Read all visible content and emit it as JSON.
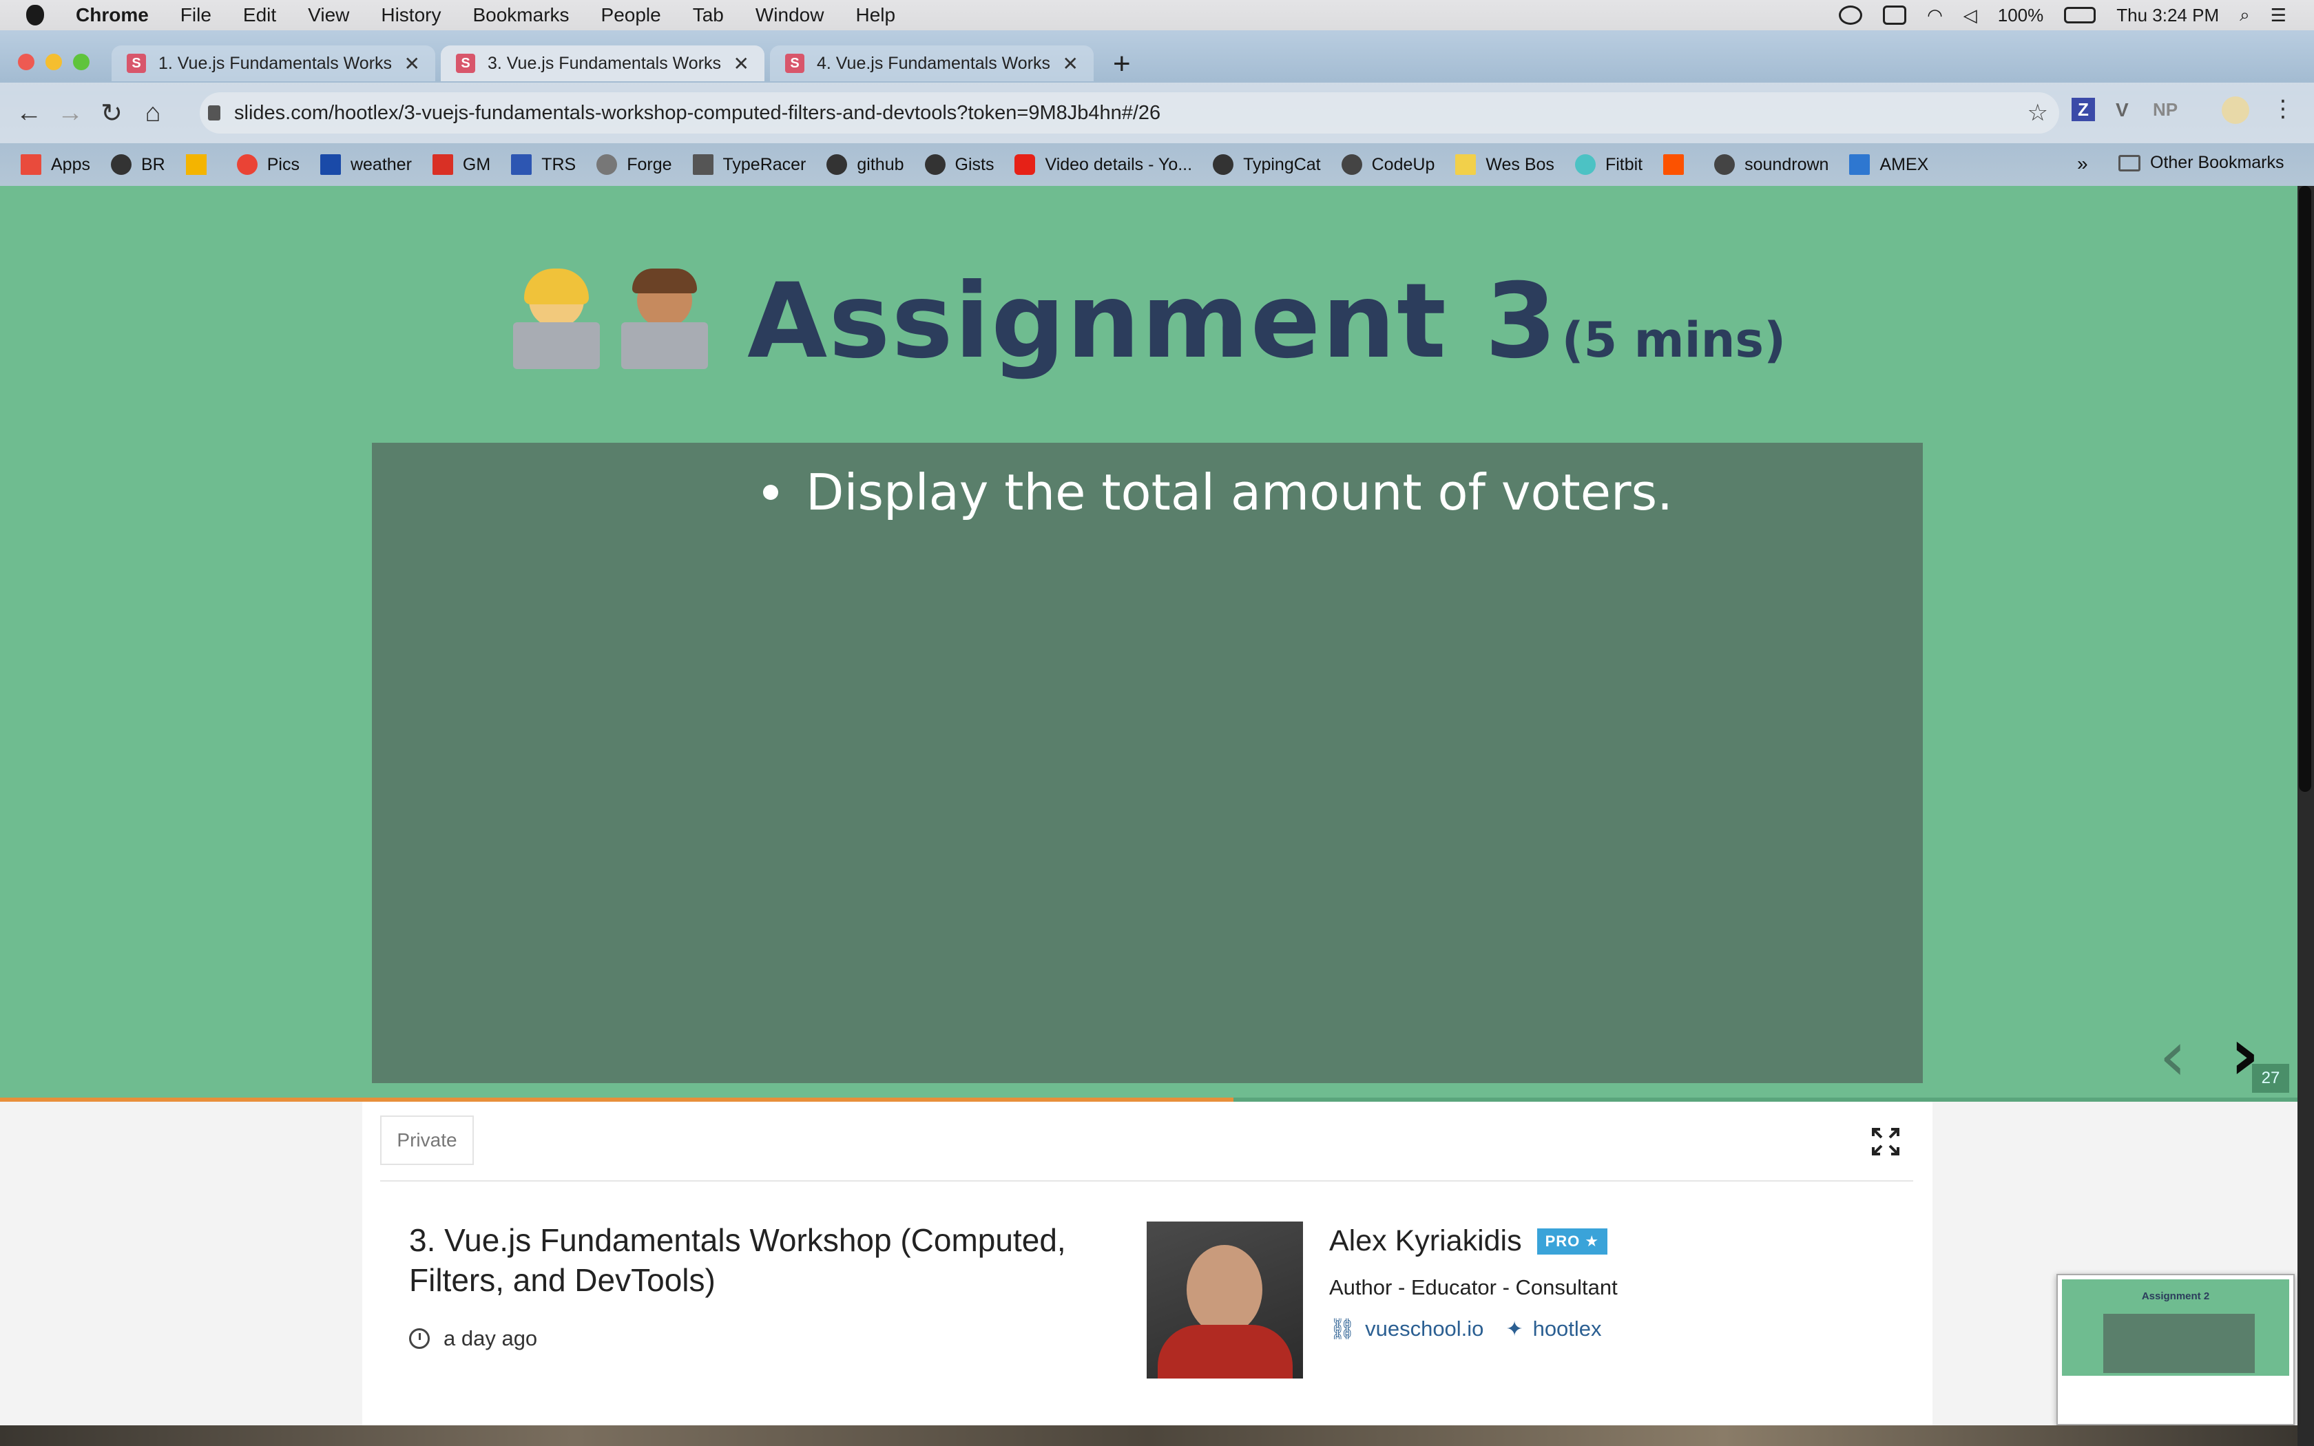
{
  "menubar": {
    "app_name": "Chrome",
    "items": [
      "File",
      "Edit",
      "View",
      "History",
      "Bookmarks",
      "People",
      "Tab",
      "Window",
      "Help"
    ],
    "battery": "100%",
    "clock": "Thu 3:24 PM"
  },
  "tabs": [
    {
      "title": "1. Vue.js Fundamentals Workshop",
      "active": false
    },
    {
      "title": "3. Vue.js Fundamentals Workshop",
      "active": true
    },
    {
      "title": "4. Vue.js Fundamentals Workshop",
      "active": false
    }
  ],
  "address": {
    "url": "slides.com/hootlex/3-vuejs-fundamentals-workshop-computed-filters-and-devtools?token=9M8Jb4hn#/26"
  },
  "toolbar_ext": [
    "Z",
    "V",
    "NP"
  ],
  "bookmarks": [
    "Apps",
    "BR",
    "",
    "Pics",
    "weather",
    "GM",
    "TRS",
    "Forge",
    "TypeRacer",
    "github",
    "Gists",
    "Video details - Yo...",
    "TypingCat",
    "CodeUp",
    "Wes Bos",
    "Fitbit",
    "",
    "soundrown",
    "AMEX"
  ],
  "bookmarks_more": "»",
  "other_bookmarks": "Other Bookmarks",
  "slide": {
    "title": "Assignment 3",
    "duration": "(5 mins)",
    "bullet": "Display the total amount of voters.",
    "number": "27",
    "progress": 0.537
  },
  "deck": {
    "visibility": "Private",
    "title": "3. Vue.js Fundamentals Workshop (Computed, Filters, and DevTools)",
    "updated": "a day ago"
  },
  "author": {
    "name": "Alex Kyriakidis",
    "badge": "PRO ★",
    "role": "Author - Educator - Consultant",
    "website": "vueschool.io",
    "twitter": "hootlex"
  },
  "pip": {
    "title": "Assignment 2"
  },
  "colors": {
    "slide_bg": "#6fbc90",
    "panel_bg": "#5a7f6b",
    "title": "#2c3d5c",
    "progress": "#e88f3a"
  }
}
